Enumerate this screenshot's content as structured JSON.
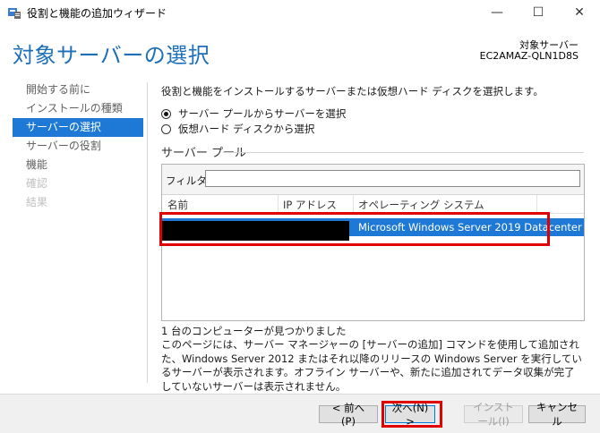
{
  "window": {
    "title": "役割と機能の追加ウィザード",
    "minimize": "—",
    "maximize": "☐",
    "close": "✕"
  },
  "header": {
    "title": "対象サーバーの選択",
    "destination_label": "対象サーバー",
    "destination_server": "EC2AMAZ-QLN1D8S"
  },
  "nav": {
    "items": [
      {
        "label": "開始する前に",
        "state": "normal"
      },
      {
        "label": "インストールの種類",
        "state": "normal"
      },
      {
        "label": "サーバーの選択",
        "state": "active"
      },
      {
        "label": "サーバーの役割",
        "state": "normal"
      },
      {
        "label": "機能",
        "state": "normal"
      },
      {
        "label": "確認",
        "state": "disabled"
      },
      {
        "label": "結果",
        "state": "disabled"
      }
    ]
  },
  "main": {
    "instruction": "役割と機能をインストールするサーバーまたは仮想ハード ディスクを選択します。",
    "radio_pool": "サーバー プールからサーバーを選択",
    "radio_vhd": "仮想ハード ディスクから選択",
    "selected_radio": "pool",
    "pool_title": "サーバー プール",
    "filter_label": "フィルター:",
    "filter_value": "",
    "columns": {
      "name": "名前",
      "ip": "IP アドレス",
      "os": "オペレーティング システム"
    },
    "rows": [
      {
        "name": "",
        "ip": "",
        "os": "Microsoft Windows Server 2019 Datacenter"
      }
    ],
    "found_text": "1 台のコンピューターが見つかりました",
    "description": "このページには、サーバー マネージャーの [サーバーの追加] コマンドを使用して追加された、Windows Server 2012 またはそれ以降のリリースの Windows Server を実行しているサーバーが表示されます。オフライン サーバーや、新たに追加されてデータ収集が完了していないサーバーは表示されません。"
  },
  "footer": {
    "prev": "< 前へ(P)",
    "next": "次へ(N) >",
    "install": "インストール(I)",
    "cancel": "キャンセル"
  },
  "colors": {
    "accent": "#1e78d6",
    "title_blue": "#1e6fb8",
    "annotation_red": "#e00000"
  }
}
